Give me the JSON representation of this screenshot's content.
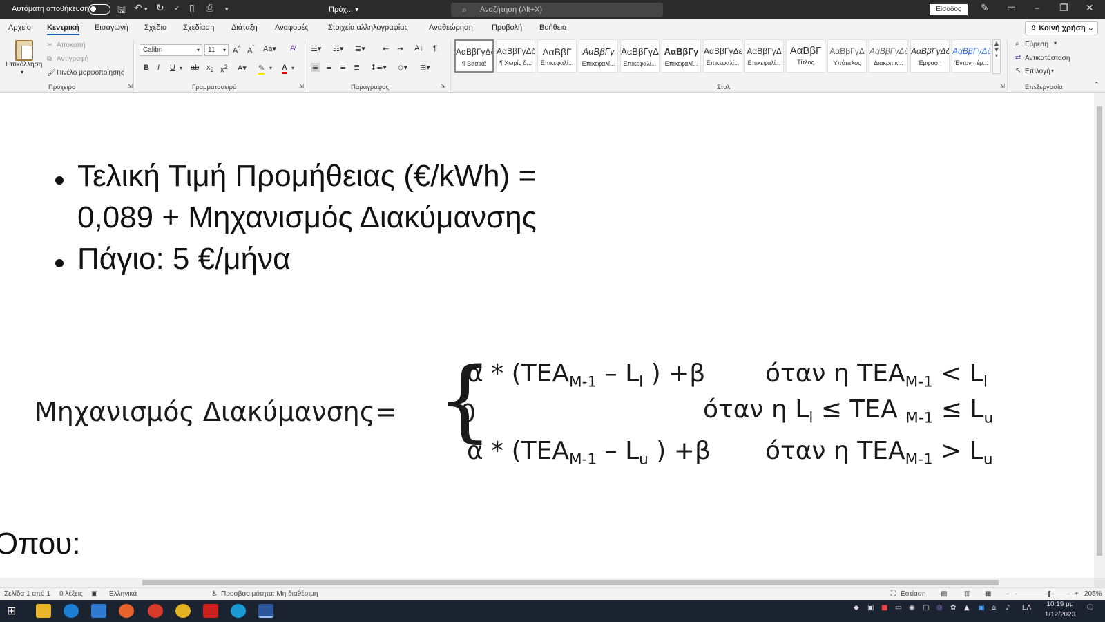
{
  "titlebar": {
    "autosave_label": "Αυτόματη αποθήκευση",
    "doc_title": "Πρόχ... ▾",
    "search_placeholder": "Αναζήτηση (Alt+X)",
    "signin_label": "Είσοδος"
  },
  "menu": {
    "tabs": [
      "Αρχείο",
      "Κεντρική",
      "Εισαγωγή",
      "Σχέδιο",
      "Σχεδίαση",
      "Διάταξη",
      "Αναφορές",
      "Στοιχεία αλληλογραφίας",
      "Αναθεώρηση",
      "Προβολή",
      "Βοήθεια"
    ],
    "active_tab": "Κεντρική",
    "share_label": "Κοινή χρήση"
  },
  "ribbon": {
    "clipboard": {
      "paste": "Επικόλληση",
      "cut": "Αποκοπή",
      "copy": "Αντιγραφή",
      "format_painter": "Πινέλο μορφοποίησης",
      "group": "Πρόχειρο"
    },
    "font": {
      "name": "Calibri",
      "size": "11",
      "group": "Γραμματοσειρά"
    },
    "paragraph": {
      "group": "Παράγραφος"
    },
    "styles": {
      "group": "Στυλ",
      "items": [
        {
          "sample": "ΑαΒβΓγΔδ",
          "name": "¶ Βασικό"
        },
        {
          "sample": "ΑαΒβΓγΔδ",
          "name": "¶ Χωρίς δ..."
        },
        {
          "sample": "ΑαΒβΓ",
          "name": "Επικεφαλί..."
        },
        {
          "sample": "ΑαΒβΓγ",
          "name": "Επικεφαλί..."
        },
        {
          "sample": "ΑαΒβΓγΔ",
          "name": "Επικεφαλί..."
        },
        {
          "sample": "ΑαΒβΓγ",
          "name": "Επικεφαλί..."
        },
        {
          "sample": "ΑαΒβΓγΔε",
          "name": "Επικεφαλί..."
        },
        {
          "sample": "ΑαΒβΓγΔ",
          "name": "Επικεφαλί..."
        },
        {
          "sample": "ΑαΒβΓ",
          "name": "Τίτλος"
        },
        {
          "sample": "ΑαΒβΓγΔ",
          "name": "Υπότιτλος"
        },
        {
          "sample": "ΑαΒβΓγΔδ",
          "name": "Διακριτικ..."
        },
        {
          "sample": "ΑαΒβΓγΔδ",
          "name": "Έμφαση"
        },
        {
          "sample": "ΑαΒβΓγΔδ",
          "name": "Έντονη έμ..."
        }
      ]
    },
    "editing": {
      "find": "Εύρεση",
      "replace": "Αντικατάσταση",
      "select": "Επιλογή",
      "group": "Επεξεργασία"
    }
  },
  "document": {
    "bullets": [
      {
        "line1": "Τελική Τιμή Προμήθειας (€/kWh) =",
        "line2": "0,089 + Μηχανισμός Διακύμανσης"
      },
      {
        "line1": "Πάγιο: 5 €/μήνα"
      }
    ],
    "formula": {
      "lhs": "Μηχανισμός Διακύμανσης=",
      "cases": [
        {
          "expr": "α * (TEA<sub>M-1</sub> – L<sub>l</sub> ) +β",
          "cond": "όταν η TEA<sub>M-1</sub> &lt; L<sub>l</sub>"
        },
        {
          "expr": "0",
          "cond": "όταν η L<sub>l</sub> ≤ TEA <sub>M-1</sub> ≤ L<sub>u</sub>"
        },
        {
          "expr": "α * (TEA<sub>M-1</sub> – L<sub>u</sub> ) +β",
          "cond": "όταν η TEA<sub>M-1</sub> &gt; L<sub>u</sub>"
        }
      ]
    },
    "footer_text": "Όπου:"
  },
  "statusbar": {
    "page": "Σελίδα 1 από 1",
    "words": "0 λέξεις",
    "language": "Ελληνικά",
    "accessibility": "Προσβασιμότητα: Μη διαθέσιμη",
    "focus": "Εστίαση",
    "zoom": "205%"
  },
  "taskbar": {
    "lang": "ΕΛ",
    "time": "10:19 μμ",
    "date": "1/12/2023"
  }
}
